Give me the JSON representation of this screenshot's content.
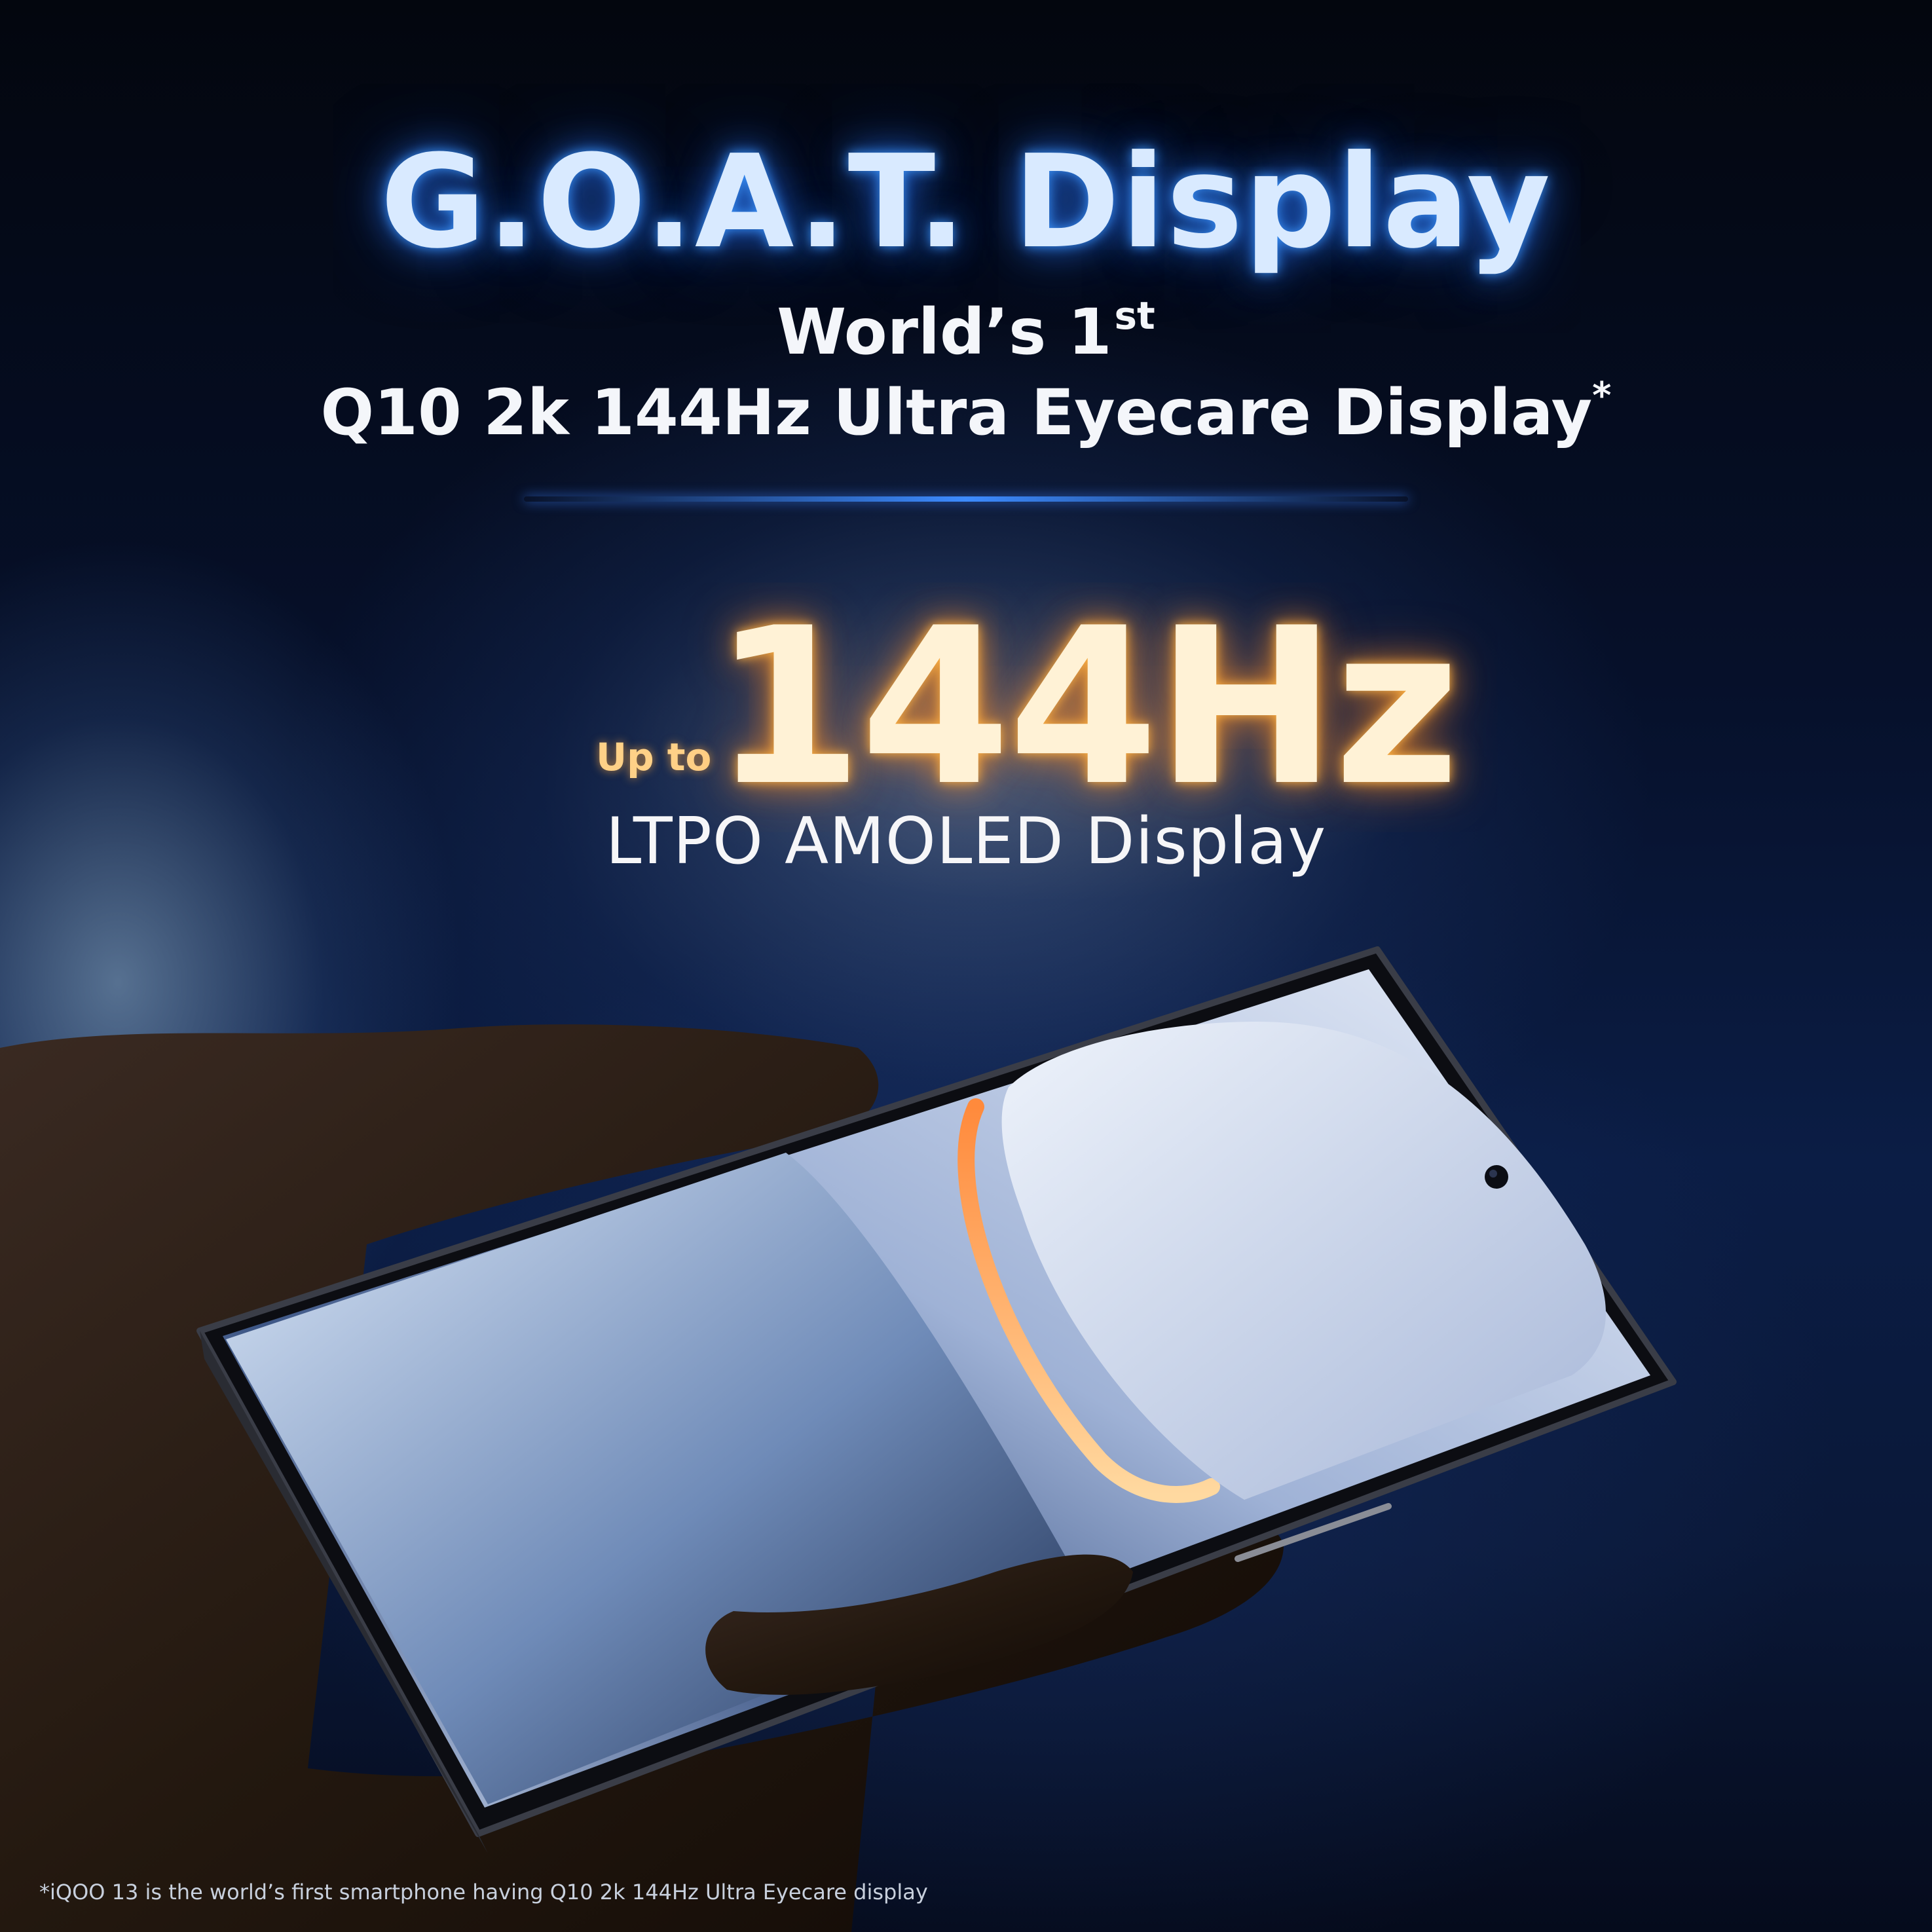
{
  "headline": "G.O.A.T. Display",
  "subheadline": {
    "line1": "World’s 1",
    "line1_sup": "st",
    "line2": "Q10 2k 144Hz Ultra Eyecare Display",
    "line2_mark": "*"
  },
  "spec": {
    "prefix": "Up to",
    "value": "144Hz",
    "label": "LTPO AMOLED Display"
  },
  "footnote": "*iQOO 13 is the world’s first smartphone having Q10 2k 144Hz Ultra Eyecare display",
  "colors": {
    "headline_glow": "#3d8bff",
    "spec_glow": "#ffb347",
    "background": "#04070f"
  }
}
